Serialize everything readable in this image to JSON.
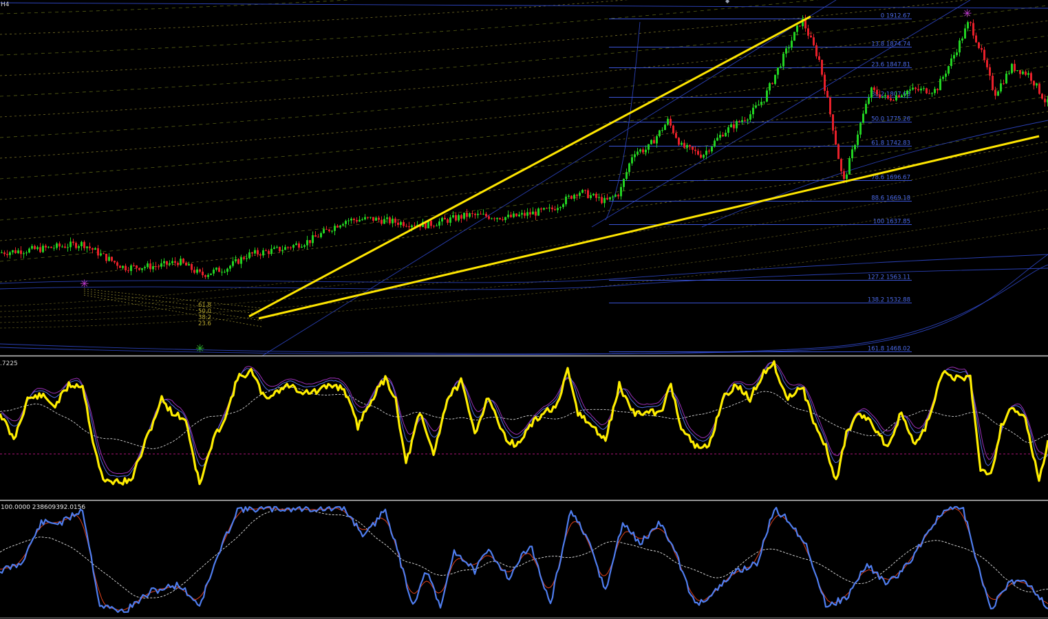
{
  "timeframe": "H4",
  "colors": {
    "background": "#000000",
    "bull_candle": "#22d322",
    "bear_candle": "#e8202a",
    "trendline": "#ffe600",
    "fib": "#3b55d9",
    "fib_label": "#4b6ae8",
    "channel_blue": "#2f47c8",
    "ma_green": "#7d8a1e",
    "ma_dashed": "#a79d35",
    "pane_border": "#c8c8c8",
    "osc1_main": "#ffee00",
    "osc1_a": "#4f6bdc",
    "osc1_b": "#9c2fb8",
    "osc1_sig": "#d8d8d8",
    "osc1_level": "#b0157a",
    "osc2_main": "#4f7ef0",
    "osc2_sig": "#e0401a",
    "osc2_slow": "#e8e8e8",
    "marker_top": "#c23cd1",
    "marker_bottom": "#2fb52f"
  },
  "fibonacci_levels": [
    {
      "label": "0 1912.67"
    },
    {
      "label": "13.8 1874.74"
    },
    {
      "label": "23.6 1847.81"
    },
    {
      "label": "38.2 1807.68"
    },
    {
      "label": "50.0 1775.26"
    },
    {
      "label": "61.8 1742.83"
    },
    {
      "label": "78.6 1696.67"
    },
    {
      "label": "88.6 1669.18"
    },
    {
      "label": "100 1637.85"
    },
    {
      "label": "127.2 1563.11"
    },
    {
      "label": "138.2 1532.88"
    },
    {
      "label": "161.8 1468.02"
    }
  ],
  "small_fib_labels": [
    "61.8",
    "50.0",
    "38.2",
    "23.6"
  ],
  "oscillator1": {
    "header": ".7225"
  },
  "oscillator2": {
    "header": "100.0000 238609392.0156"
  },
  "chart_data": [
    {
      "type": "candlestick",
      "pane": "price",
      "close_path": [
        {
          "x": 0,
          "close": 1600
        },
        {
          "x": 60,
          "close": 1605
        },
        {
          "x": 120,
          "close": 1612
        },
        {
          "x": 150,
          "close": 1595
        },
        {
          "x": 180,
          "close": 1580
        },
        {
          "x": 230,
          "close": 1582
        },
        {
          "x": 260,
          "close": 1588
        },
        {
          "x": 292,
          "close": 1570
        },
        {
          "x": 330,
          "close": 1580
        },
        {
          "x": 360,
          "close": 1597
        },
        {
          "x": 410,
          "close": 1605
        },
        {
          "x": 450,
          "close": 1616
        },
        {
          "x": 500,
          "close": 1643
        },
        {
          "x": 540,
          "close": 1645
        },
        {
          "x": 580,
          "close": 1640
        },
        {
          "x": 620,
          "close": 1637
        },
        {
          "x": 680,
          "close": 1650
        },
        {
          "x": 740,
          "close": 1647
        },
        {
          "x": 800,
          "close": 1657
        },
        {
          "x": 840,
          "close": 1682
        },
        {
          "x": 880,
          "close": 1668
        },
        {
          "x": 900,
          "close": 1680
        },
        {
          "x": 920,
          "close": 1735
        },
        {
          "x": 940,
          "close": 1738
        },
        {
          "x": 970,
          "close": 1776
        },
        {
          "x": 990,
          "close": 1742
        },
        {
          "x": 1020,
          "close": 1730
        },
        {
          "x": 1050,
          "close": 1760
        },
        {
          "x": 1090,
          "close": 1785
        },
        {
          "x": 1110,
          "close": 1806
        },
        {
          "x": 1140,
          "close": 1865
        },
        {
          "x": 1165,
          "close": 1912
        },
        {
          "x": 1190,
          "close": 1857
        },
        {
          "x": 1210,
          "close": 1767
        },
        {
          "x": 1225,
          "close": 1692
        },
        {
          "x": 1245,
          "close": 1757
        },
        {
          "x": 1265,
          "close": 1817
        },
        {
          "x": 1290,
          "close": 1805
        },
        {
          "x": 1320,
          "close": 1817
        },
        {
          "x": 1360,
          "close": 1817
        },
        {
          "x": 1385,
          "close": 1862
        },
        {
          "x": 1408,
          "close": 1909
        },
        {
          "x": 1425,
          "close": 1869
        },
        {
          "x": 1445,
          "close": 1812
        },
        {
          "x": 1470,
          "close": 1848
        },
        {
          "x": 1495,
          "close": 1838
        },
        {
          "x": 1520,
          "close": 1800
        }
      ]
    },
    {
      "type": "line",
      "pane": "oscillator1",
      "series": [
        {
          "points": [
            [
              0,
              600
            ],
            [
              20,
              640
            ],
            [
              40,
              580
            ],
            [
              60,
              575
            ],
            [
              80,
              590
            ],
            [
              100,
              560
            ],
            [
              120,
              560
            ],
            [
              135,
              640
            ],
            [
              150,
              700
            ],
            [
              170,
              700
            ],
            [
              190,
              700
            ],
            [
              205,
              660
            ],
            [
              220,
              620
            ],
            [
              235,
              580
            ],
            [
              250,
              600
            ],
            [
              270,
              610
            ],
            [
              290,
              705
            ],
            [
              310,
              640
            ],
            [
              330,
              600
            ],
            [
              345,
              550
            ],
            [
              365,
              540
            ],
            [
              385,
              580
            ],
            [
              400,
              570
            ],
            [
              420,
              560
            ],
            [
              440,
              570
            ],
            [
              460,
              570
            ],
            [
              480,
              560
            ],
            [
              500,
              565
            ],
            [
              520,
              620
            ],
            [
              540,
              580
            ],
            [
              560,
              550
            ],
            [
              575,
              580
            ],
            [
              590,
              675
            ],
            [
              610,
              600
            ],
            [
              630,
              660
            ],
            [
              650,
              580
            ],
            [
              670,
              555
            ],
            [
              690,
              630
            ],
            [
              710,
              575
            ],
            [
              730,
              630
            ],
            [
              750,
              650
            ],
            [
              770,
              620
            ],
            [
              790,
              600
            ],
            [
              810,
              590
            ],
            [
              825,
              540
            ],
            [
              840,
              600
            ],
            [
              860,
              620
            ],
            [
              880,
              640
            ],
            [
              900,
              560
            ],
            [
              920,
              600
            ],
            [
              940,
              600
            ],
            [
              960,
              600
            ],
            [
              975,
              560
            ],
            [
              990,
              620
            ],
            [
              1010,
              650
            ],
            [
              1030,
              650
            ],
            [
              1050,
              580
            ],
            [
              1070,
              560
            ],
            [
              1090,
              580
            ],
            [
              1110,
              540
            ],
            [
              1125,
              530
            ],
            [
              1145,
              580
            ],
            [
              1165,
              560
            ],
            [
              1185,
              620
            ],
            [
              1200,
              650
            ],
            [
              1215,
              700
            ],
            [
              1230,
              630
            ],
            [
              1250,
              600
            ],
            [
              1270,
              620
            ],
            [
              1290,
              650
            ],
            [
              1310,
              600
            ],
            [
              1330,
              650
            ],
            [
              1350,
              610
            ],
            [
              1370,
              540
            ],
            [
              1390,
              550
            ],
            [
              1410,
              550
            ],
            [
              1425,
              680
            ],
            [
              1440,
              690
            ],
            [
              1455,
              620
            ],
            [
              1470,
              590
            ],
            [
              1490,
              610
            ],
            [
              1510,
              700
            ],
            [
              1523,
              640
            ]
          ]
        }
      ]
    },
    {
      "type": "line",
      "pane": "oscillator2",
      "series": [
        {
          "points": [
            [
              0,
              830
            ],
            [
              30,
              820
            ],
            [
              60,
              760
            ],
            [
              90,
              760
            ],
            [
              120,
              740
            ],
            [
              145,
              880
            ],
            [
              180,
              890
            ],
            [
              220,
              860
            ],
            [
              260,
              850
            ],
            [
              290,
              880
            ],
            [
              320,
              800
            ],
            [
              345,
              740
            ],
            [
              380,
              740
            ],
            [
              420,
              740
            ],
            [
              460,
              740
            ],
            [
              500,
              740
            ],
            [
              530,
              780
            ],
            [
              560,
              740
            ],
            [
              580,
              810
            ],
            [
              600,
              880
            ],
            [
              620,
              830
            ],
            [
              640,
              885
            ],
            [
              660,
              800
            ],
            [
              690,
              830
            ],
            [
              710,
              800
            ],
            [
              740,
              840
            ],
            [
              770,
              790
            ],
            [
              800,
              880
            ],
            [
              830,
              740
            ],
            [
              860,
              800
            ],
            [
              880,
              860
            ],
            [
              905,
              760
            ],
            [
              930,
              790
            ],
            [
              960,
              760
            ],
            [
              980,
              800
            ],
            [
              1010,
              880
            ],
            [
              1040,
              860
            ],
            [
              1070,
              830
            ],
            [
              1100,
              820
            ],
            [
              1125,
              740
            ],
            [
              1150,
              760
            ],
            [
              1175,
              800
            ],
            [
              1200,
              880
            ],
            [
              1230,
              870
            ],
            [
              1260,
              820
            ],
            [
              1290,
              850
            ],
            [
              1320,
              820
            ],
            [
              1350,
              770
            ],
            [
              1375,
              740
            ],
            [
              1400,
              740
            ],
            [
              1420,
              820
            ],
            [
              1440,
              885
            ],
            [
              1465,
              850
            ],
            [
              1485,
              840
            ],
            [
              1505,
              860
            ],
            [
              1523,
              885
            ]
          ]
        }
      ]
    }
  ]
}
